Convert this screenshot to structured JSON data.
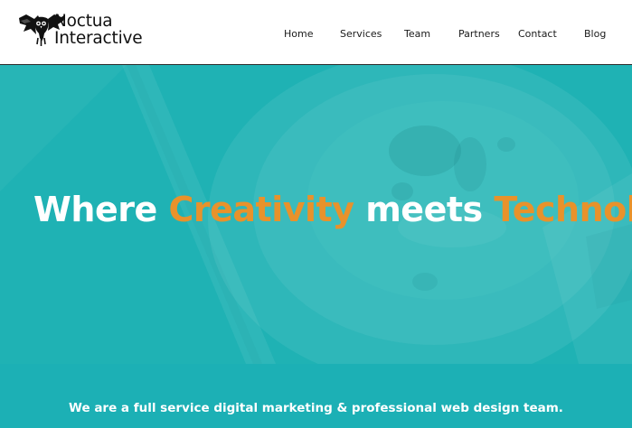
{
  "brand": {
    "line1": "Noctua",
    "line2": "Interactive"
  },
  "nav": [
    {
      "label": "Home"
    },
    {
      "label": "Services"
    },
    {
      "label": "Team"
    },
    {
      "label": "Partners"
    },
    {
      "label": "Contact"
    },
    {
      "label": "Blog"
    }
  ],
  "hero": {
    "word1": "Where",
    "word2": "Creativity",
    "word3": "meets",
    "word4": "Technology"
  },
  "band": {
    "text": "We are a full service digital marketing & professional web design team."
  },
  "colors": {
    "accent": "#e8922b",
    "teal": "#1fb2b4",
    "header_bg": "#ffffff",
    "text_dark": "#1a1a1a"
  }
}
